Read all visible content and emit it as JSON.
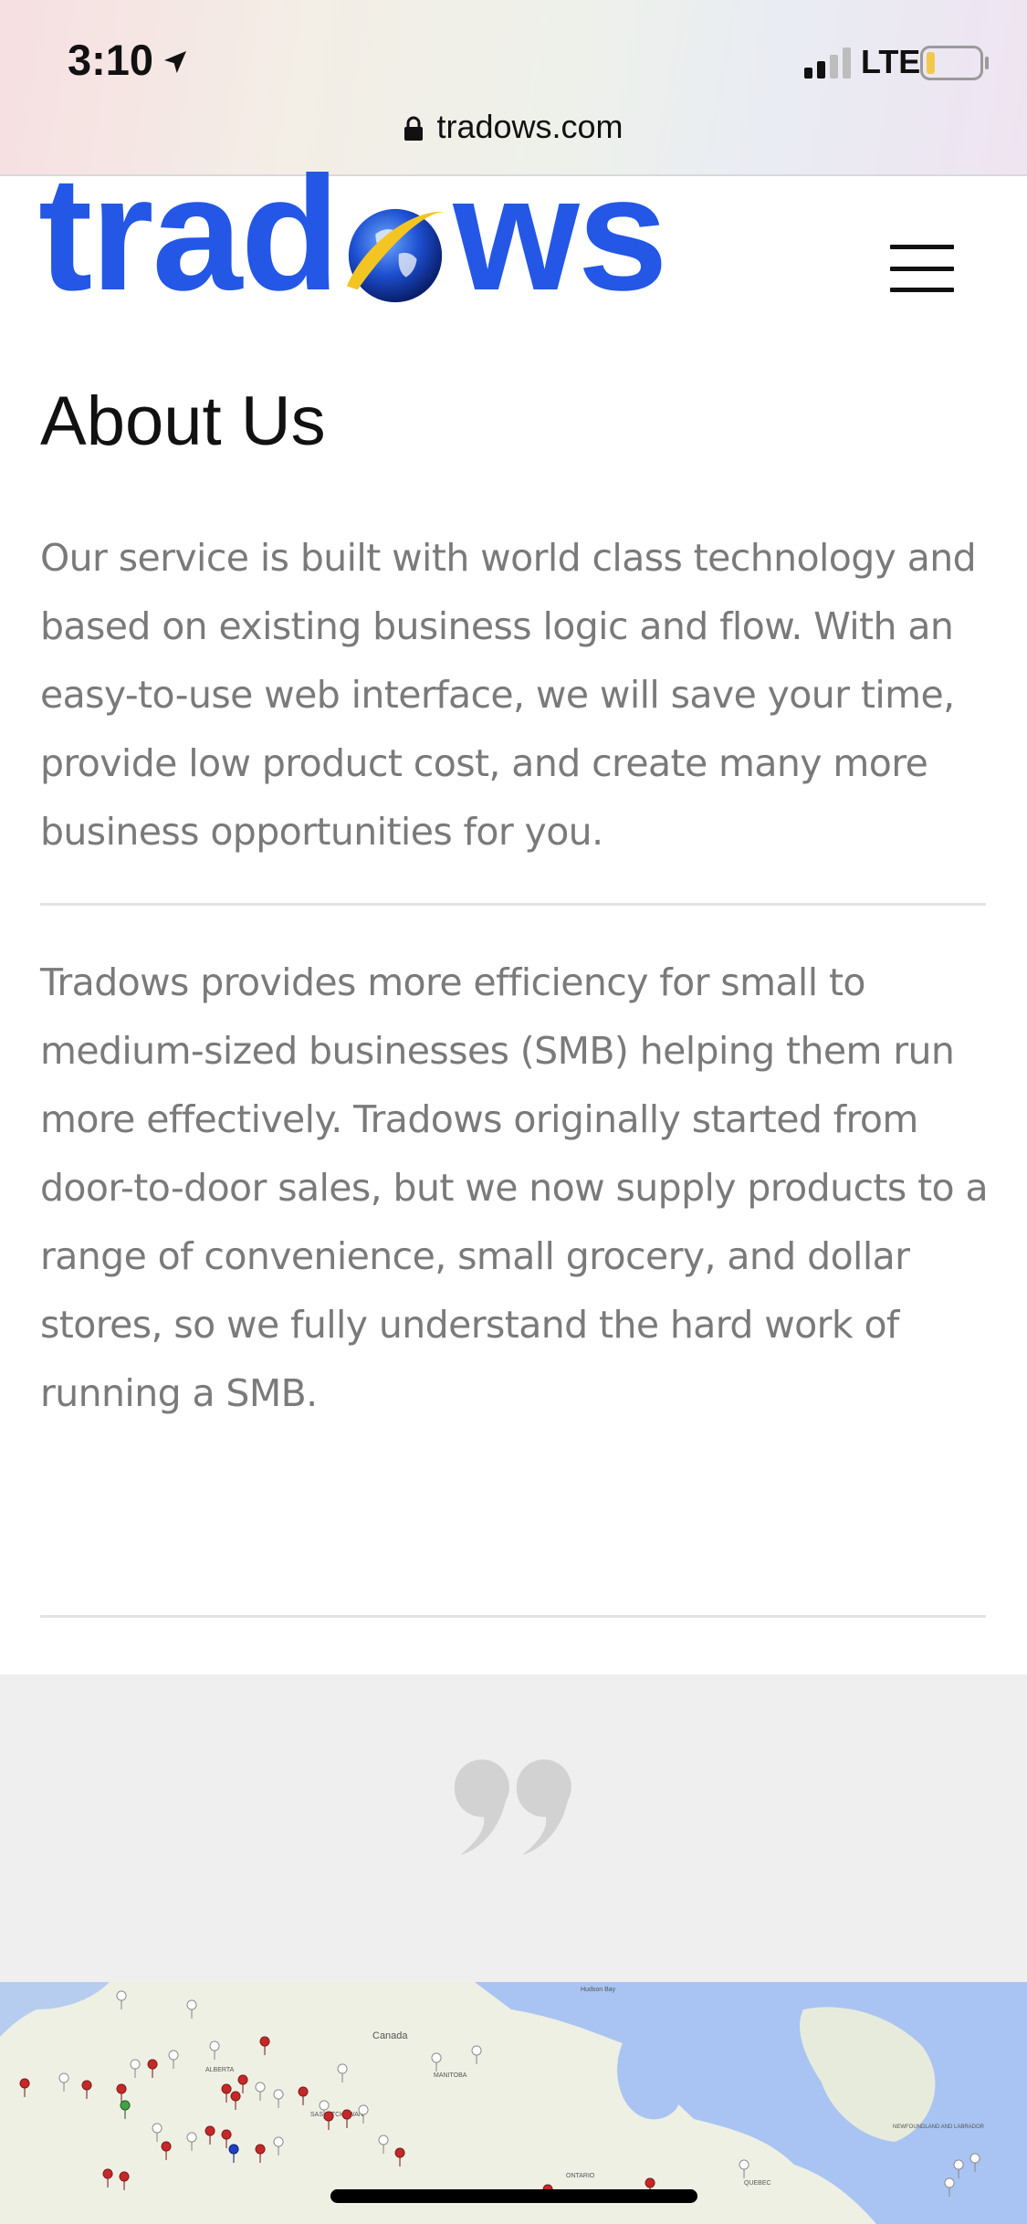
{
  "status_bar": {
    "time": "3:10",
    "network": "LTE",
    "battery_level": 0.15
  },
  "browser": {
    "url": "tradows.com"
  },
  "header": {
    "logo_left": "trad",
    "logo_right": "ws",
    "brand_color": "#2457e6",
    "menu_icon": "hamburger-icon"
  },
  "main": {
    "title": "About Us",
    "paragraph1": "Our service is built with world class technology and based on existing business logic and flow. With an easy-to-use web interface, we will save your time, provide low product cost, and create many more business opportunities for you.",
    "paragraph2": "Tradows provides more efficiency for small to medium-sized businesses (SMB) helping them run more effectively. Tradows originally started from door-to-door sales, but we now supply products to a range of convenience, small grocery, and dollar stores, so we fully understand the hard work of running a SMB."
  },
  "testimonial": {
    "icon": "quote-icon"
  },
  "map": {
    "labels": [
      "Canada",
      "ALBERTA",
      "SASKATCHEWAN",
      "MANITOBA",
      "ONTARIO",
      "QUEBEC",
      "Hudson Bay",
      "NEWFOUNDLAND AND LABRADOR"
    ]
  }
}
